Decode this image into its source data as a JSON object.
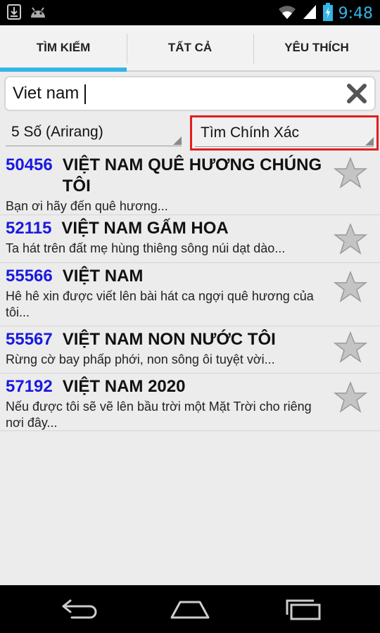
{
  "status_bar": {
    "time": "9:48",
    "icons_left": [
      "download-icon",
      "android-icon"
    ],
    "icons_right": [
      "wifi-icon",
      "signal-icon",
      "battery-icon"
    ]
  },
  "tabs": [
    {
      "label": "TÌM KIẾM",
      "active": true
    },
    {
      "label": "TẤT CẢ",
      "active": false
    },
    {
      "label": "YÊU THÍCH",
      "active": false
    }
  ],
  "search": {
    "value": "Viet nam",
    "clear_icon": "close-icon"
  },
  "filters": {
    "digits": "5 Số (Arirang)",
    "mode": "Tìm Chính Xác"
  },
  "results": [
    {
      "number": "50456",
      "title": "VIỆT NAM QUÊ HƯƠNG CHÚNG TÔI",
      "lyric": "Bạn ơi hãy đến quê hương..."
    },
    {
      "number": "52115",
      "title": "VIỆT NAM GẤM HOA",
      "lyric": "Ta hát trên đất mẹ hùng thiêng sông núi dạt dào..."
    },
    {
      "number": "55566",
      "title": "VIỆT NAM",
      "lyric": "Hê hê xin được viết lên bài hát ca ngợi quê hương của tôi..."
    },
    {
      "number": "55567",
      "title": "VIỆT NAM NON NƯỚC TÔI",
      "lyric": "Rừng cờ bay phấp phới, non sông ôi tuyệt vời..."
    },
    {
      "number": "57192",
      "title": "VIỆT NAM 2020",
      "lyric": "Nếu được tôi sẽ vẽ lên bầu trời một Mặt Trời cho riêng nơi đây..."
    }
  ],
  "nav_bar": {
    "icons": [
      "back-icon",
      "home-icon",
      "recents-icon"
    ]
  }
}
